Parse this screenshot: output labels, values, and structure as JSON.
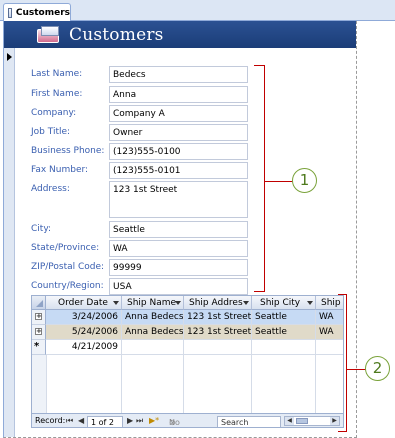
{
  "tab": {
    "label": "Customers",
    "icon": "form-icon"
  },
  "header": {
    "title": "Customers",
    "icon": "customers-form-icon"
  },
  "fields": [
    {
      "label": "Last Name:",
      "value": "Bedecs"
    },
    {
      "label": "First Name:",
      "value": "Anna"
    },
    {
      "label": "Company:",
      "value": "Company A"
    },
    {
      "label": "Job Title:",
      "value": "Owner"
    },
    {
      "label": "Business Phone:",
      "value": "(123)555-0100"
    },
    {
      "label": "Fax Number:",
      "value": "(123)555-0101"
    },
    {
      "label": "Address:",
      "value": "123 1st Street"
    },
    {
      "label": "City:",
      "value": "Seattle"
    },
    {
      "label": "State/Province:",
      "value": "WA"
    },
    {
      "label": "ZIP/Postal Code:",
      "value": "99999"
    },
    {
      "label": "Country/Region:",
      "value": "USA"
    }
  ],
  "subform": {
    "columns": [
      "Order Date",
      "Ship Name",
      "Ship Addres",
      "Ship City",
      "Ship S"
    ],
    "rows": [
      {
        "marker": "+",
        "cells": [
          "3/24/2006",
          "Anna Bedecs",
          "123 1st Street",
          "Seattle",
          "WA"
        ]
      },
      {
        "marker": "+",
        "cells": [
          "5/24/2006",
          "Anna Bedecs",
          "123 1st Street",
          "Seattle",
          "WA"
        ]
      }
    ],
    "new_row": {
      "marker": "*",
      "cells": [
        "4/21/2009",
        "",
        "",
        "",
        ""
      ]
    }
  },
  "navigation": {
    "record_label": "Record:",
    "first": "⏮",
    "prev": "◀",
    "position": "1 of 2",
    "next": "▶",
    "last": "⏭",
    "new": "▶*",
    "filter": "No Filter",
    "search_placeholder": "Search"
  },
  "callouts": [
    "1",
    "2"
  ],
  "colors": {
    "header_bg": "#1b3d78",
    "label_text": "#3a5fb0",
    "bracket": "#c00000",
    "callout": "#7aa23a",
    "row_selected": "#c6daf4",
    "row_current": "#e0dac9"
  }
}
